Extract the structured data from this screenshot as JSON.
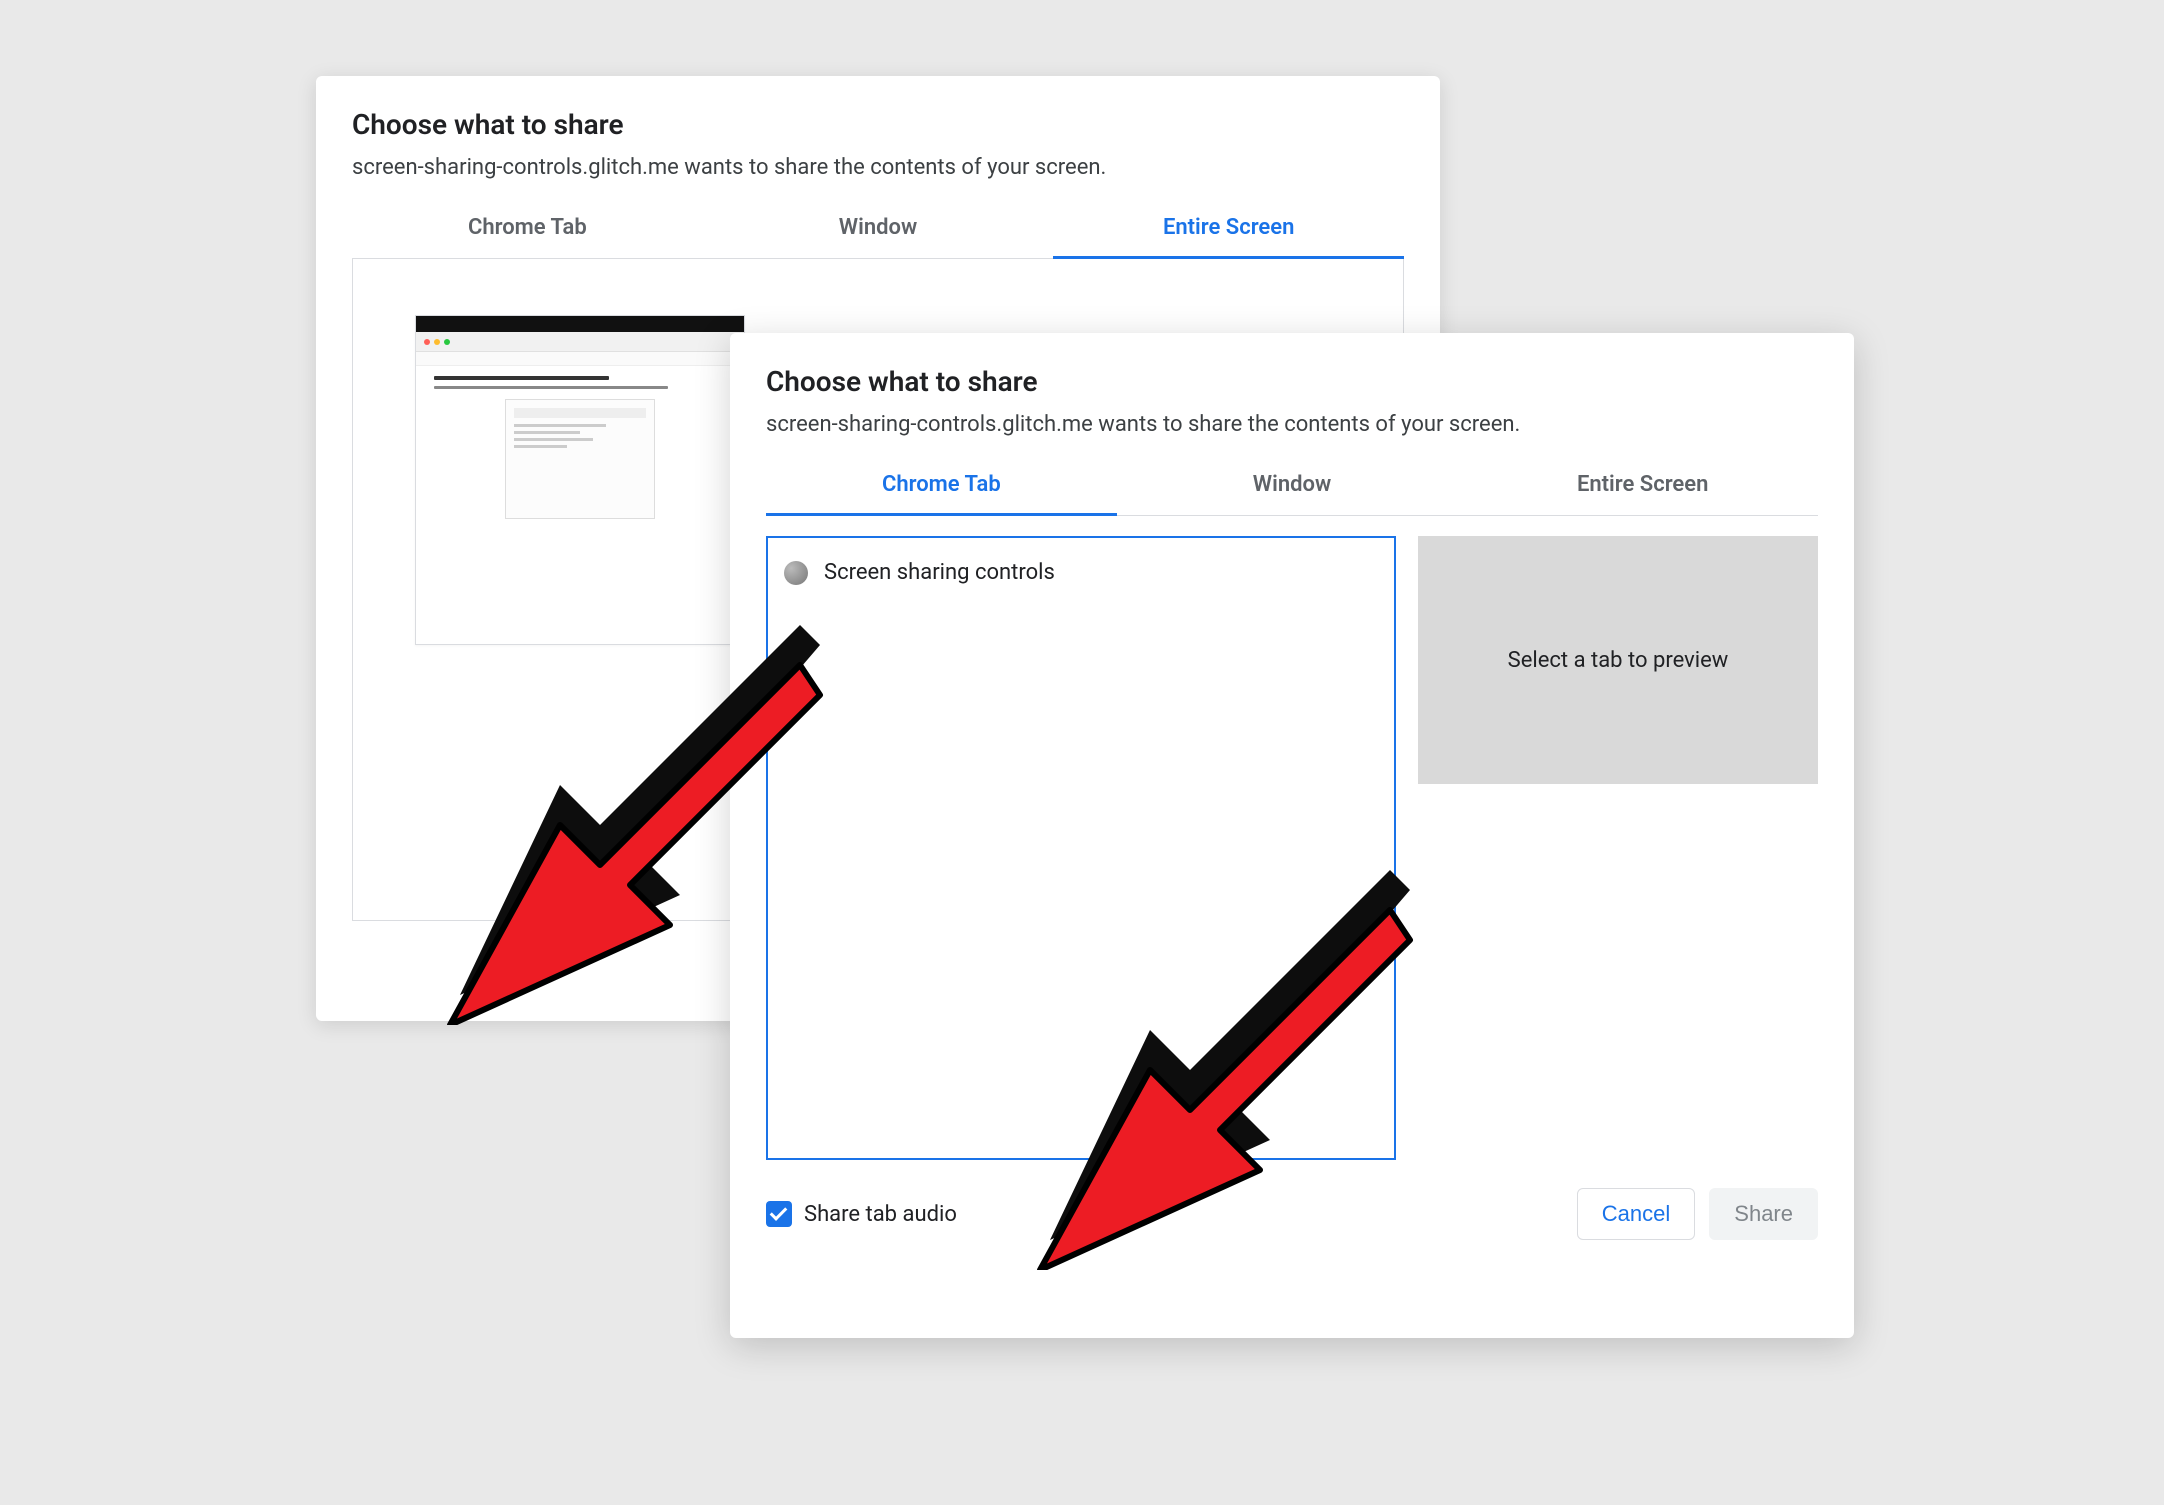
{
  "dialog_back": {
    "title": "Choose what to share",
    "subtitle": "screen-sharing-controls.glitch.me wants to share the contents of your screen.",
    "tabs": [
      {
        "label": "Chrome Tab",
        "active": false
      },
      {
        "label": "Window",
        "active": false
      },
      {
        "label": "Entire Screen",
        "active": true
      }
    ]
  },
  "dialog_front": {
    "title": "Choose what to share",
    "subtitle": "screen-sharing-controls.glitch.me wants to share the contents of your screen.",
    "tabs": [
      {
        "label": "Chrome Tab",
        "active": true
      },
      {
        "label": "Window",
        "active": false
      },
      {
        "label": "Entire Screen",
        "active": false
      }
    ],
    "tab_items": [
      {
        "label": "Screen sharing controls"
      }
    ],
    "preview_placeholder": "Select a tab to preview",
    "share_audio_label": "Share tab audio",
    "share_audio_checked": true,
    "cancel_label": "Cancel",
    "share_label": "Share"
  }
}
